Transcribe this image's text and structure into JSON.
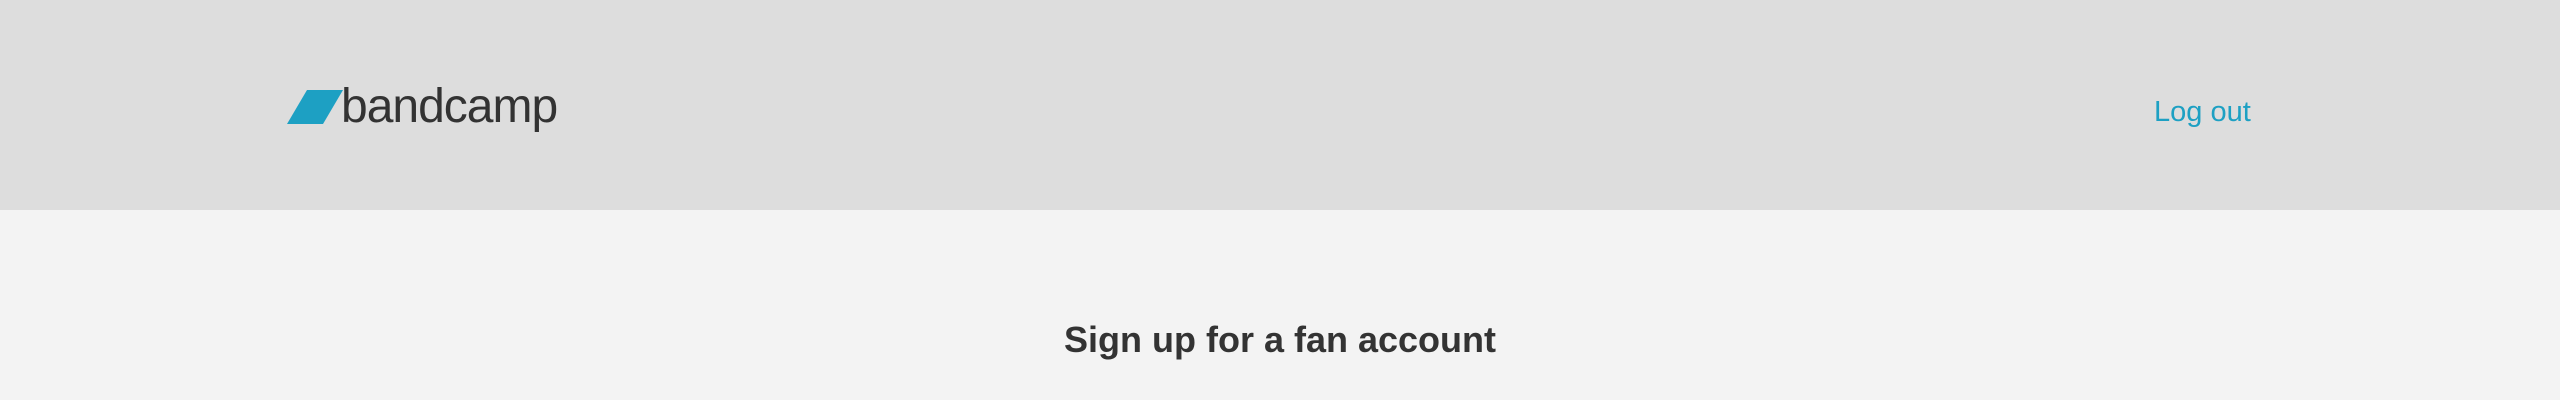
{
  "header": {
    "logo_text": "bandcamp",
    "logout_label": "Log out"
  },
  "main": {
    "title": "Sign up for a fan account"
  },
  "colors": {
    "header_background": "#dddddd",
    "page_background": "#f3f3f3",
    "brand_accent": "#1da0c3",
    "text_primary": "#333333"
  },
  "icons": {
    "logo_mark": "bandcamp-parallelogram-icon"
  }
}
